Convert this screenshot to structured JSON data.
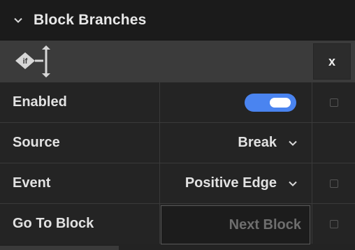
{
  "header": {
    "title": "Block Branches",
    "collapse_icon": "chevron-down-icon"
  },
  "block": {
    "icon": "if-branch-icon",
    "icon_text": "if",
    "close_label": "x"
  },
  "rows": [
    {
      "label": "Enabled",
      "control": "toggle",
      "toggle_on": true,
      "has_checkbox": true
    },
    {
      "label": "Source",
      "control": "dropdown",
      "value": "Break",
      "has_checkbox": false
    },
    {
      "label": "Event",
      "control": "dropdown",
      "value": "Positive Edge",
      "has_checkbox": true
    },
    {
      "label": "Go To Block",
      "control": "input",
      "placeholder": "Next Block",
      "has_checkbox": true
    }
  ],
  "colors": {
    "accent": "#4a84f0",
    "panel": "#232323",
    "header": "#1b1b1b",
    "block_row": "#3b3b3b"
  }
}
